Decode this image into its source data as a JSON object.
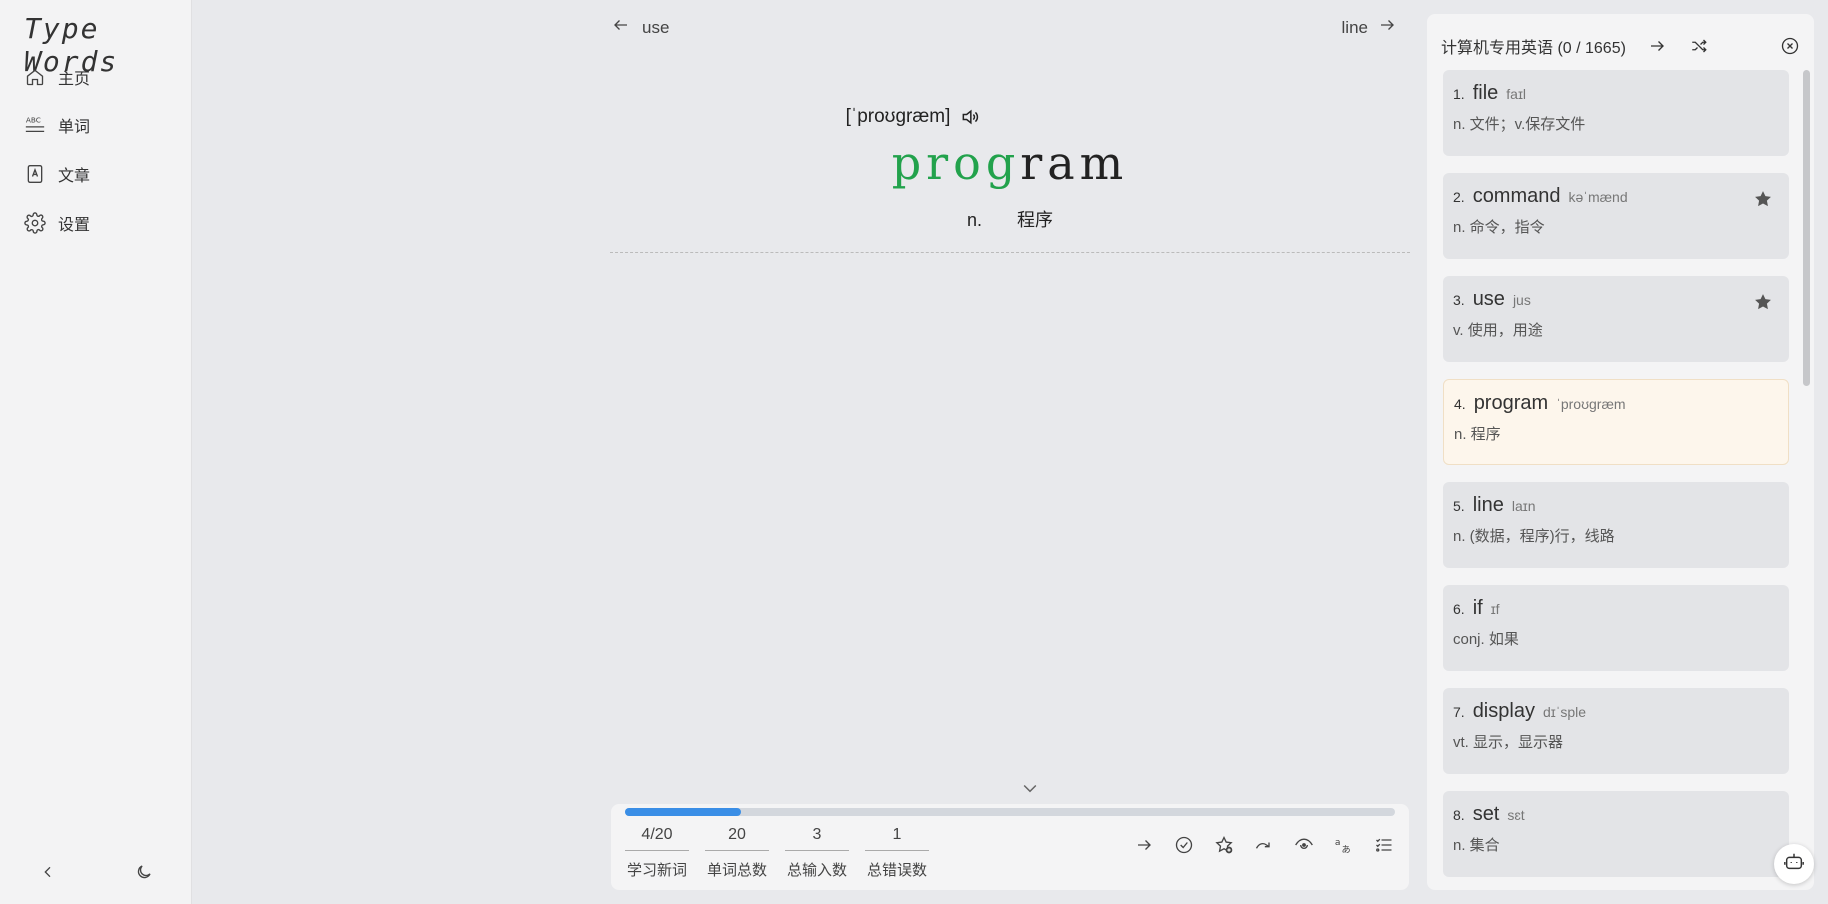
{
  "app": {
    "logo": "Type Words"
  },
  "sidebar": {
    "items": [
      {
        "label": "主页",
        "icon": "home-icon"
      },
      {
        "label": "单词",
        "icon": "abc-icon"
      },
      {
        "label": "文章",
        "icon": "article-icon"
      },
      {
        "label": "设置",
        "icon": "gear-icon"
      }
    ],
    "bottom": {
      "collapse_icon": "chevron-left-icon",
      "theme_icon": "moon-icon"
    }
  },
  "main": {
    "prev_word": "use",
    "next_word": "line",
    "phonetic": "[ˈproʊɡræm]",
    "word_typed": "prog",
    "word_rest": "ram",
    "translation_pos": "n.",
    "translation": "程序"
  },
  "stats": {
    "progress": 0.15,
    "items": [
      {
        "value": "4/20",
        "label": "学习新词"
      },
      {
        "value": "20",
        "label": "单词总数"
      },
      {
        "value": "3",
        "label": "总输入数"
      },
      {
        "value": "1",
        "label": "总错误数"
      }
    ],
    "tools": [
      "arrow-right-icon",
      "check-circle-icon",
      "star-add-icon",
      "skip-icon",
      "eye-icon",
      "translate-icon",
      "list-icon"
    ]
  },
  "panel": {
    "title": "计算机专用英语 (0 / 1665)",
    "words": [
      {
        "num": "1.",
        "word": "file",
        "phonetic": "faɪl",
        "trans": "n. 文件；v.保存文件",
        "starred": false,
        "active": false
      },
      {
        "num": "2.",
        "word": "command",
        "phonetic": "kəˈmænd",
        "trans": "n. 命令，指令",
        "starred": true,
        "active": false
      },
      {
        "num": "3.",
        "word": "use",
        "phonetic": "jus",
        "trans": "v. 使用，用途",
        "starred": true,
        "active": false
      },
      {
        "num": "4.",
        "word": "program",
        "phonetic": "ˈproʊɡræm",
        "trans": "n. 程序",
        "starred": false,
        "active": true
      },
      {
        "num": "5.",
        "word": "line",
        "phonetic": "laɪn",
        "trans": "n. (数据，程序)行，线路",
        "starred": false,
        "active": false
      },
      {
        "num": "6.",
        "word": "if",
        "phonetic": "ɪf",
        "trans": "conj. 如果",
        "starred": false,
        "active": false
      },
      {
        "num": "7.",
        "word": "display",
        "phonetic": "dɪˈsple",
        "trans": "vt. 显示，显示器",
        "starred": false,
        "active": false
      },
      {
        "num": "8.",
        "word": "set",
        "phonetic": "sɛt",
        "trans": "n. 集合",
        "starred": false,
        "active": false
      }
    ]
  }
}
